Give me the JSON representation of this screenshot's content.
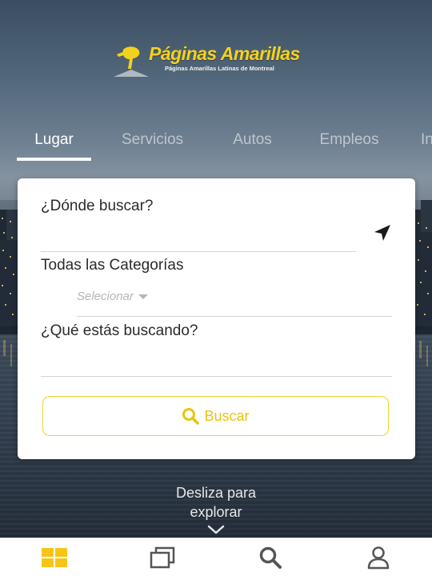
{
  "logo": {
    "title": "Páginas Amarillas",
    "subtitle": "Páginas Amarillas Latinas de Montreal"
  },
  "tabs": [
    {
      "label": "Lugar",
      "active": true
    },
    {
      "label": "Servicios",
      "active": false
    },
    {
      "label": "Autos",
      "active": false
    },
    {
      "label": "Empleos",
      "active": false
    },
    {
      "label": "In",
      "active": false
    }
  ],
  "search_form": {
    "where_label": "¿Dónde buscar?",
    "where_value": "",
    "categories_label": "Todas las Categorías",
    "category_select": "Selecionar",
    "what_label": "¿Qué estás buscando?",
    "what_value": "",
    "search_button_label": "Buscar"
  },
  "swipe_hint": {
    "line1": "Desliza para",
    "line2": "explorar"
  },
  "bottom_nav": [
    {
      "icon": "grid-icon",
      "active": true
    },
    {
      "icon": "pages-icon",
      "active": false
    },
    {
      "icon": "search-icon",
      "active": false
    },
    {
      "icon": "user-icon",
      "active": false
    }
  ],
  "colors": {
    "brand_yellow": "#f4d21c",
    "button_yellow": "#e9c412",
    "nav_active": "#f5c518",
    "nav_inactive": "#555555"
  }
}
